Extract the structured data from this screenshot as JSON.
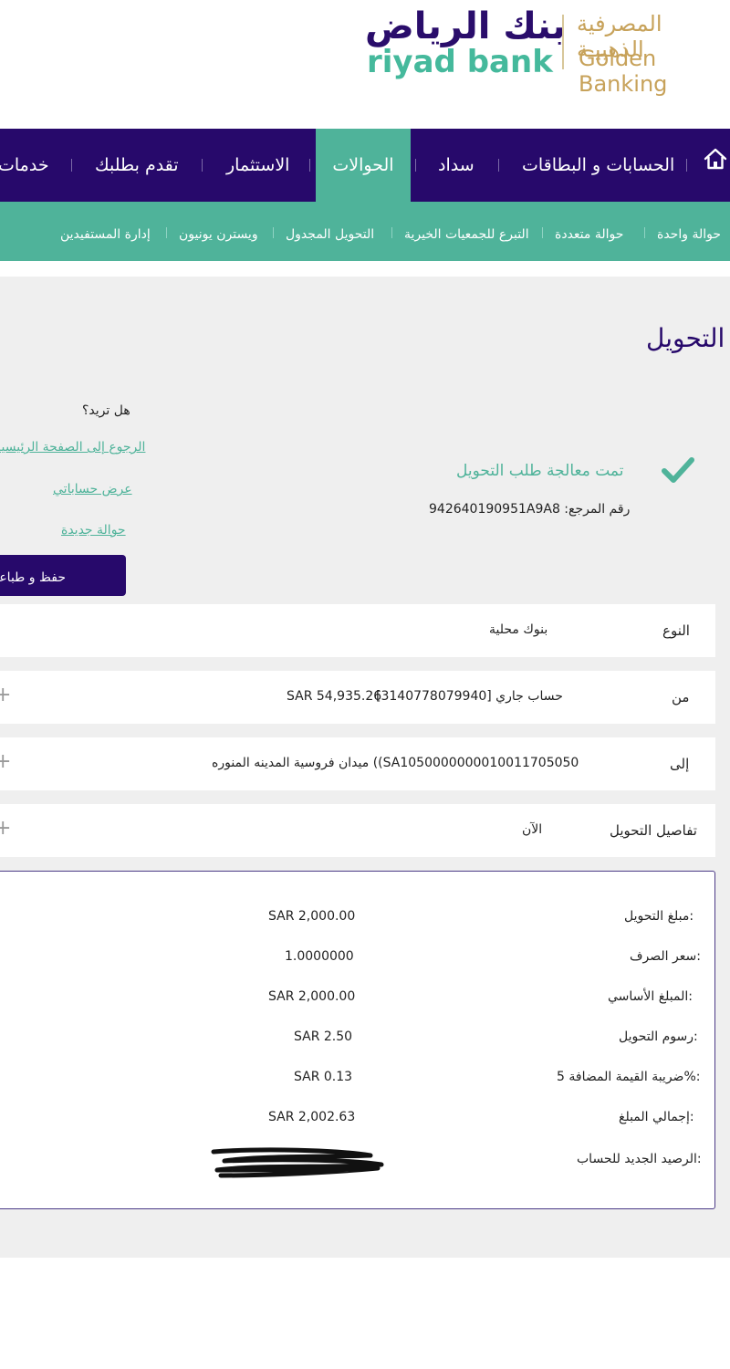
{
  "brand": {
    "name_ar": "بنك الرياض",
    "name_en": "riyad bank",
    "tier_ar": "المصرفية الذهبيـة",
    "tier_en": "Golden Banking",
    "colors": {
      "primary": "#27096b",
      "accent": "#4fb39a",
      "gold": "#c7a25a"
    }
  },
  "nav": {
    "home_icon": "home-icon",
    "items": [
      {
        "label": "الحسابات و البطاقات"
      },
      {
        "label": "سداد"
      },
      {
        "label": "الحوالات",
        "active": true
      },
      {
        "label": "الاستثمار"
      },
      {
        "label": "تقدم بطلبك"
      },
      {
        "label": "خدمات"
      }
    ]
  },
  "subnav": {
    "items": [
      {
        "label": "حوالة واحدة"
      },
      {
        "label": "حوالة متعددة"
      },
      {
        "label": "التبرع للجمعيات الخيرية"
      },
      {
        "label": "التحويل المجدول"
      },
      {
        "label": "ويسترن يونيون"
      },
      {
        "label": "إدارة المستفيدين"
      }
    ]
  },
  "page": {
    "title": "التحويل",
    "success_title": "تمت معالجة طلب التحويل",
    "reference": "رقم المرجع: 942640190951A9A8",
    "want_label": "هل تريد؟",
    "links": {
      "home": "الرجوع إلى الصفحة الرئيسية",
      "accounts": "عرض حساباتي",
      "new_transfer": "حوالة جديدة"
    },
    "print_button": "حفظ و طباعة"
  },
  "rows": {
    "type": {
      "label": "النوع",
      "value": "بنوك محلية"
    },
    "from": {
      "label": "من",
      "value_account": "حساب جاري [3140778079940]",
      "value_balance": "SAR 54,935.26"
    },
    "to": {
      "label": "إلى",
      "value": "ميدان فروسية المدينه المنوره ((SA1050000000010011705050"
    },
    "details": {
      "label": "تفاصيل التحويل",
      "value": "الآن"
    }
  },
  "details_box": {
    "items": [
      {
        "label": "مبلغ التحويل:",
        "value": "SAR 2,000.00"
      },
      {
        "label": "سعر الصرف:",
        "value": "1.0000000"
      },
      {
        "label": "المبلغ الأساسي:",
        "value": "SAR 2,000.00"
      },
      {
        "label": "رسوم التحويل:",
        "value": "SAR 2.50"
      },
      {
        "label": "ضريبة القيمة المضافة 5%:",
        "value": "SAR 0.13"
      },
      {
        "label": "إجمالي المبلغ:",
        "value": "SAR 2,002.63"
      },
      {
        "label": "الرصيد الجديد للحساب:",
        "value": ""
      }
    ]
  }
}
